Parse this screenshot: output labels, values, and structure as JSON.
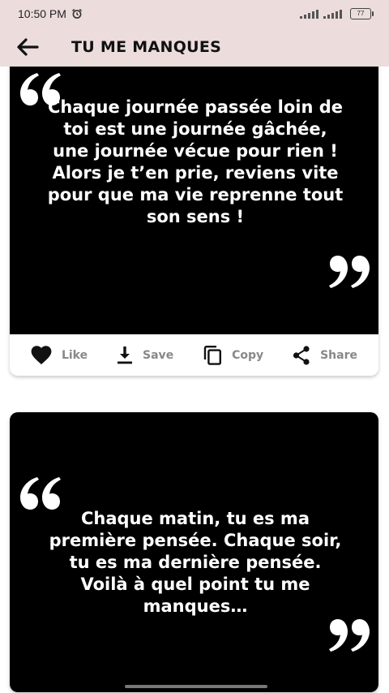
{
  "status_bar": {
    "time": "10:50 PM",
    "battery": "77"
  },
  "app_bar": {
    "title": "TU ME MANQUES"
  },
  "quotes": [
    {
      "text": "Chaque journée passée loin de toi est une journée gâchée, une journée vécue pour rien ! Alors je t’en prie, reviens vite pour que ma vie reprenne tout son sens !"
    },
    {
      "text": "Chaque matin, tu es ma première pensée. Chaque soir, tu es ma dernière pensée. Voilà à quel point tu me manques…"
    }
  ],
  "actions": {
    "like": "Like",
    "save": "Save",
    "copy": "Copy",
    "share": "Share"
  },
  "icons": [
    "arrow-back-icon",
    "alarm-icon",
    "signal-icon",
    "battery-icon",
    "open-quote-icon",
    "close-quote-icon",
    "heart-icon",
    "download-icon",
    "copy-icon",
    "share-icon"
  ],
  "colors": {
    "app_bar_background": "#ecdcdc",
    "quote_background": "#000000",
    "quote_text": "#ffffff",
    "action_text": "#888888"
  }
}
